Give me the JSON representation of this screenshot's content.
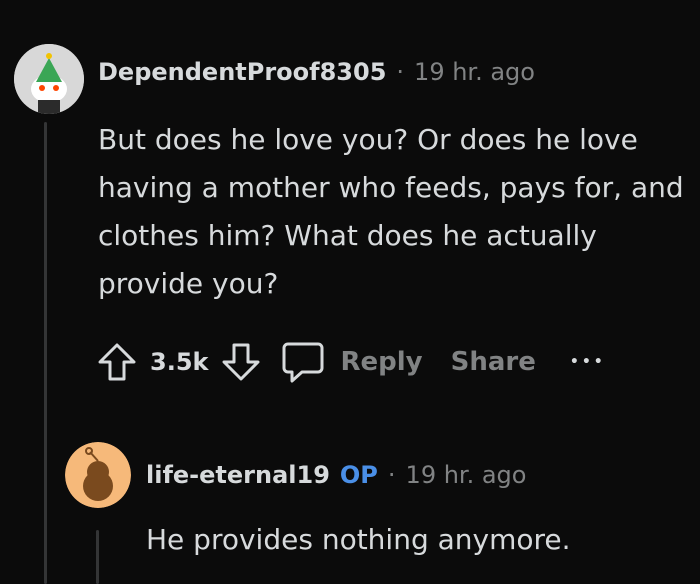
{
  "comment": {
    "username": "DependentProof8305",
    "separator": "·",
    "time": "19 hr. ago",
    "body": "But does he love you? Or does he love having a mother who feeds, pays for, and clothes him? What does he actually provide you?",
    "score": "3.5k",
    "reply_label": "Reply",
    "share_label": "Share",
    "more_label": "•••"
  },
  "reply": {
    "username": "life-eternal19",
    "op_badge": "OP",
    "separator": "·",
    "time": "19 hr. ago",
    "body": "He provides nothing anymore."
  },
  "colors": {
    "background": "#0b0b0b",
    "text": "#d7dadc",
    "muted": "#818384",
    "op_badge": "#4a8fe7",
    "thread_line": "#343536"
  }
}
